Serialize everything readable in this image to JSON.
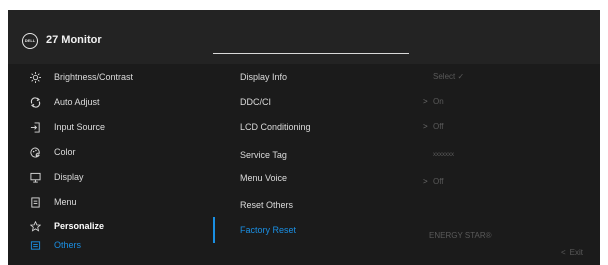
{
  "header": {
    "logo": "DELL",
    "title": "27 Monitor"
  },
  "menu": [
    {
      "label": "Brightness/Contrast",
      "icon": "brightness-icon"
    },
    {
      "label": "Auto Adjust",
      "icon": "auto-adjust-icon"
    },
    {
      "label": "Input Source",
      "icon": "input-source-icon"
    },
    {
      "label": "Color",
      "icon": "color-icon"
    },
    {
      "label": "Display",
      "icon": "display-icon"
    },
    {
      "label": "Menu",
      "icon": "menu-icon"
    },
    {
      "label": "Personalize",
      "icon": "star-icon"
    },
    {
      "label": "Others",
      "icon": "others-icon"
    }
  ],
  "submenu": [
    {
      "label": "Display Info",
      "value": "Select ✓"
    },
    {
      "label": "DDC/CI",
      "value": "On",
      "chevron": ">"
    },
    {
      "label": "LCD Conditioning",
      "value": "Off",
      "chevron": ">"
    },
    {
      "label": "Service Tag",
      "value": "xxxxxxx"
    },
    {
      "label": "Menu Voice",
      "value": "Off",
      "chevron": ">"
    },
    {
      "label": "Reset Others",
      "value": ""
    },
    {
      "label": "Factory Reset",
      "value": ""
    }
  ],
  "energy_star": "ENERGY STAR®",
  "exit": {
    "chevron": "<",
    "label": "Exit"
  },
  "colors": {
    "accent": "#1a8fe3",
    "background": "#1b1b1b"
  }
}
